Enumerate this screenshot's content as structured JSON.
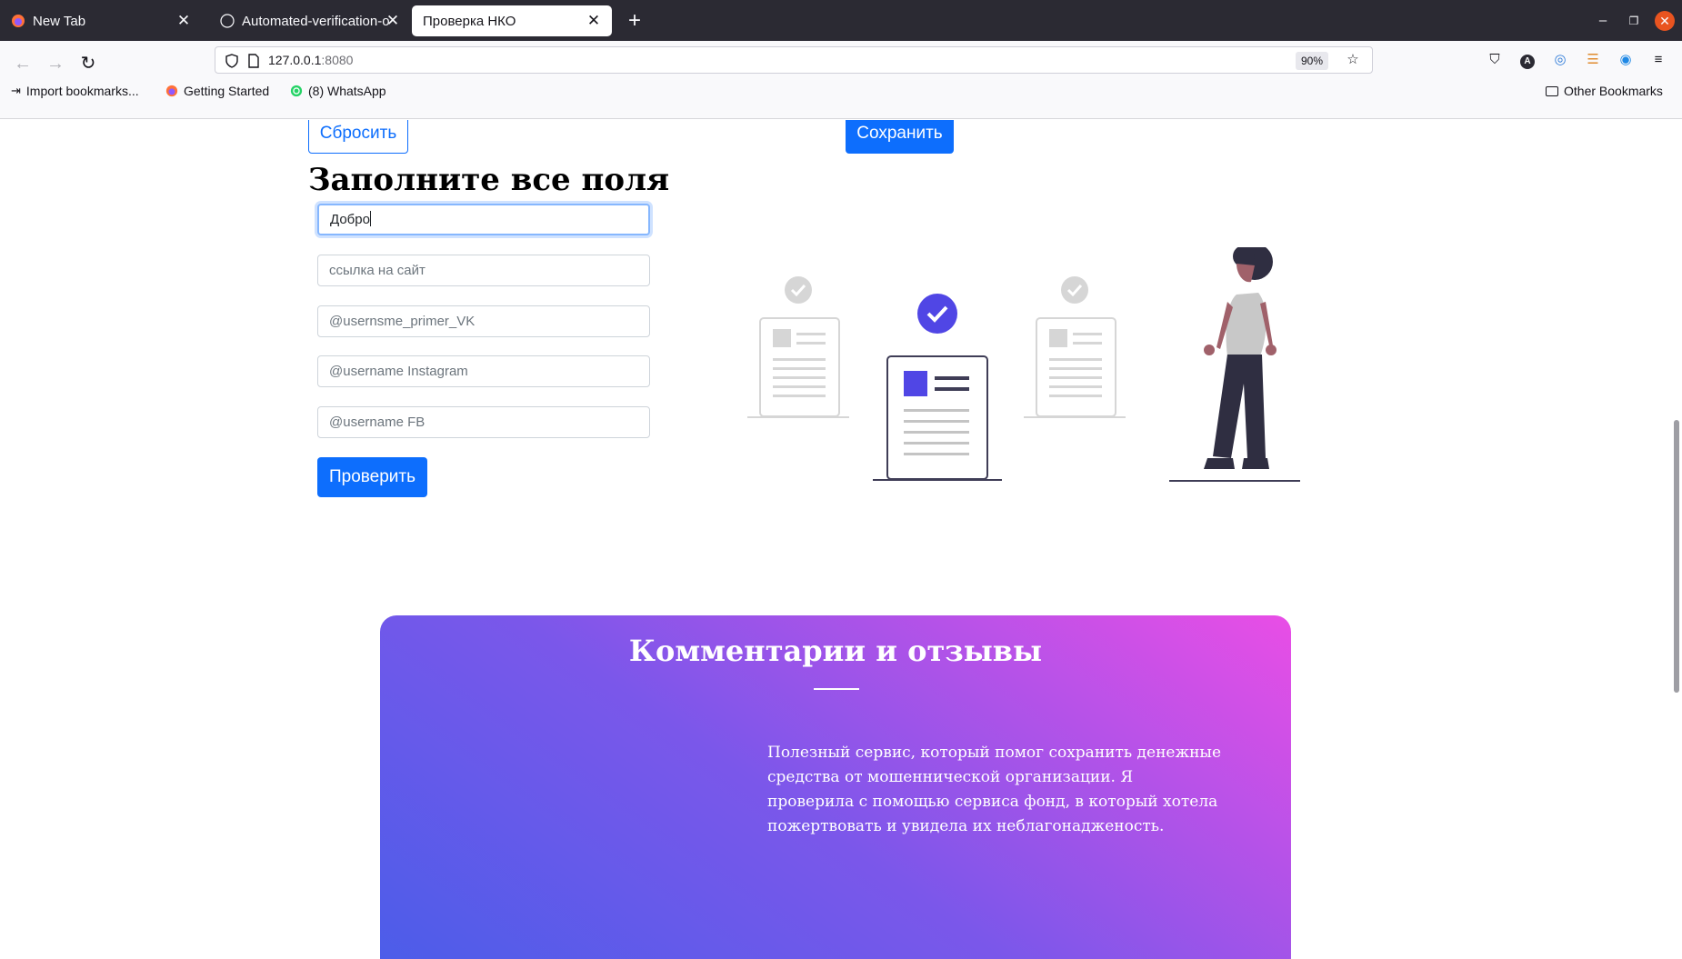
{
  "browser": {
    "tabs": [
      {
        "title": "New Tab",
        "active": false
      },
      {
        "title": "Automated-verification-o",
        "active": false
      },
      {
        "title": "Проверка НКО",
        "active": true
      }
    ],
    "url_host": "127.0.0.1",
    "url_port": ":8080",
    "zoom": "90%",
    "bookmarks": [
      {
        "label": "Import bookmarks...",
        "icon": "import-icon"
      },
      {
        "label": "Getting Started",
        "icon": "firefox-icon"
      },
      {
        "label": "(8) WhatsApp",
        "icon": "whatsapp-icon"
      }
    ],
    "other_bookmarks": "Other Bookmarks"
  },
  "page": {
    "reset_button": "Сбросить",
    "save_button": "Сохранить",
    "form_title": "Заполните все поля",
    "fields": {
      "name_value": "Добро",
      "site_placeholder": "ссылка на сайт",
      "vk_placeholder": "@usernsme_primer_VK",
      "instagram_placeholder": "@username Instagram",
      "fb_placeholder": "@username  FB"
    },
    "check_button": "Проверить",
    "reviews": {
      "title": "Комментарии и отзывы",
      "text": "Полезный сервис, который помог сохранить денежные средства от мошеннической организации. Я проверила с помощью сервиса фонд, в который хотела пожертвовать и увидела их неблагонадженость."
    }
  },
  "colors": {
    "primary": "#0d6efd",
    "illustration_accent": "#5046e5",
    "gradient_start": "#4c5de9",
    "gradient_end": "#e94ee6"
  }
}
